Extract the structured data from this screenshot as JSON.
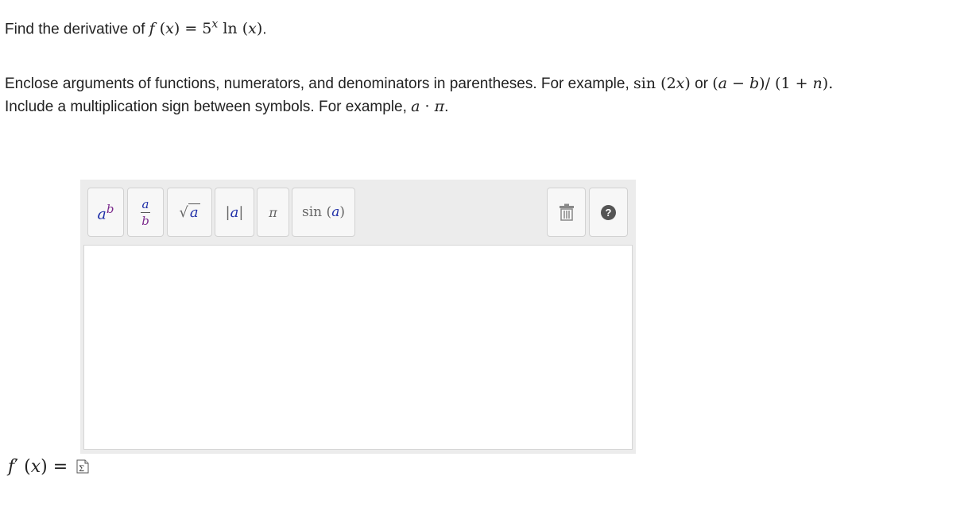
{
  "question": {
    "prefix": "Find the derivative of ",
    "f": "f",
    "lp": " (",
    "x": "x",
    "rp": ")",
    "eq": " = ",
    "base": "5",
    "exp": "x",
    "ln": " ln",
    "lp2": " (",
    "x2": "x",
    "rp2": ")",
    "end": "."
  },
  "instructions": {
    "line1_text": "Enclose arguments of functions, numerators, and denominators in parentheses. For example, ",
    "line1_ex1": "sin (2",
    "line1_ex1_var": "x",
    "line1_ex1_end": ")",
    "line1_or": " or ",
    "line1_ex2_a": "(",
    "line1_ex2_va": "a",
    "line1_ex2_minus": " − ",
    "line1_ex2_vb": "b",
    "line1_ex2_mid": ")/ (1 + ",
    "line1_ex2_vn": "n",
    "line1_ex2_end": ").",
    "line2_text": "Include a multiplication sign between symbols. For example, ",
    "line2_va": "a",
    "line2_dot": " · ",
    "line2_pi": "π",
    "line2_end": "."
  },
  "toolbar": {
    "power_base": "a",
    "power_exp": "b",
    "frac_num": "a",
    "frac_den": "b",
    "sqrt_arg": "a",
    "abs_arg": "a",
    "pi": "π",
    "sin_fn": "sin",
    "sin_arg": "a",
    "help_symbol": "?"
  },
  "answer": {
    "f": "f",
    "prime": "′",
    "lp": " (",
    "x": "x",
    "rp": ")",
    "eq": " ="
  },
  "colors": {
    "accent_blue": "#1f2fa8",
    "accent_purple": "#7b2a8c"
  }
}
